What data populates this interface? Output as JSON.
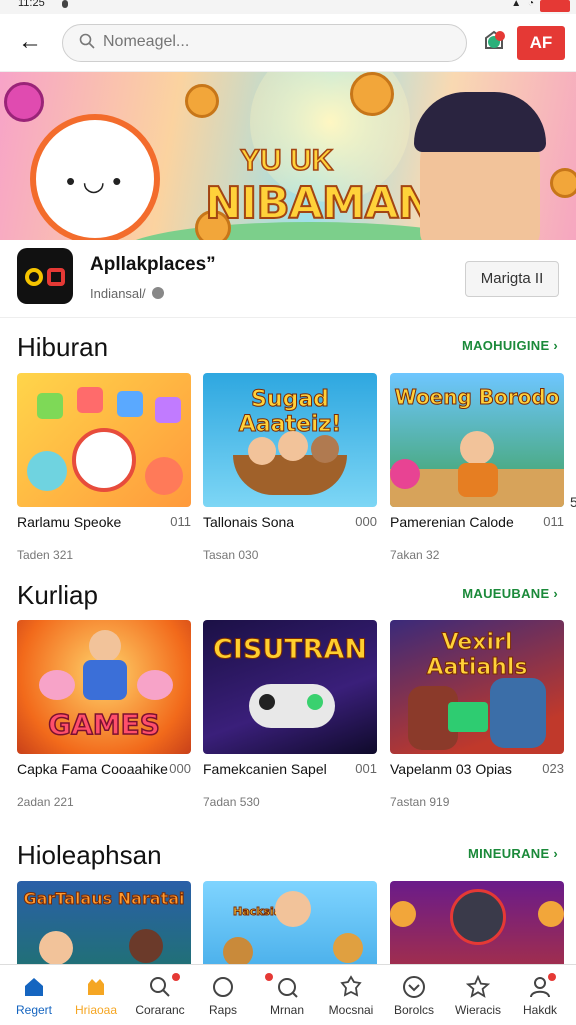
{
  "status": {
    "time": "11:25"
  },
  "header": {
    "search_placeholder": "Nomeagel...",
    "badge_label": "AF"
  },
  "banner": {
    "title_top": "YU UK",
    "title_main": "NIBAMAN"
  },
  "app": {
    "name": "Apllakplaces”",
    "subtitle": "Indiansal/",
    "action_label": "Marigta II",
    "edge_text": "5"
  },
  "sections": [
    {
      "title": "Hiburan",
      "more": "MAOHUIGINE",
      "cards": [
        {
          "name": "Rarlamu Speoke",
          "count": "011",
          "sub": "Taden 321",
          "thumb_text": ""
        },
        {
          "name": "Tallonais Sona",
          "count": "000",
          "sub": "Tasan 030",
          "thumb_text": "Sugad Aaateiz!"
        },
        {
          "name": "Pamerenian Calode",
          "count": "011",
          "sub": "7akan 32",
          "thumb_text": "Woeng Borodo"
        }
      ]
    },
    {
      "title": "Kurliap",
      "more": "MAUEUBANE",
      "cards": [
        {
          "name": "Capka Fama Cooaahike",
          "count": "000",
          "sub": "2adan 221",
          "thumb_text": "GAMES"
        },
        {
          "name": "Famekcanien Sapel",
          "count": "001",
          "sub": "7adan 530",
          "thumb_text": "CISUTRAN"
        },
        {
          "name": "Vapelanm 03 Opias",
          "count": "023",
          "sub": "7astan 919",
          "thumb_text": "Vexirl Aatiahls"
        }
      ]
    },
    {
      "title": "Hioleaphsan",
      "more": "MINEURANE",
      "cards": [
        {
          "thumb_text": "GarTalaus Naratai"
        },
        {
          "thumb_text": "Hacksia"
        },
        {
          "thumb_text": ""
        }
      ]
    }
  ],
  "tabs": [
    {
      "label": "Regert",
      "icon": "home-icon",
      "active": true
    },
    {
      "label": "Hriaoaa",
      "icon": "bag-icon",
      "active": false
    },
    {
      "label": "Coraranc",
      "icon": "search-icon",
      "active": false
    },
    {
      "label": "Raps",
      "icon": "circle-icon",
      "active": false
    },
    {
      "label": "Mrnan",
      "icon": "search-icon",
      "active": false
    },
    {
      "label": "Mocsnai",
      "icon": "puzzle-icon",
      "active": false
    },
    {
      "label": "Borolcs",
      "icon": "chevron-circle-icon",
      "active": false
    },
    {
      "label": "Wieracis",
      "icon": "star-icon",
      "active": false
    },
    {
      "label": "Hakdk",
      "icon": "user-icon",
      "active": false
    }
  ],
  "colors": {
    "accent": "#e53935",
    "link_green": "#1b8a3a",
    "tab_active": "#1565c0",
    "tab_active_label": "#f5a623"
  }
}
